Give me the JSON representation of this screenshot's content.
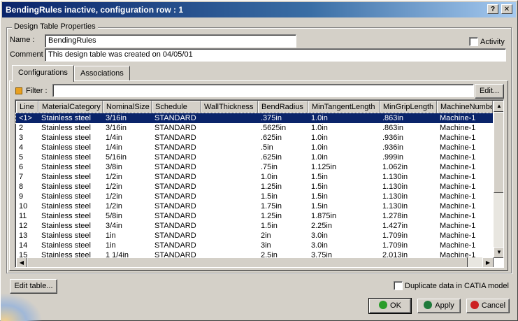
{
  "window": {
    "title": "BendingRules inactive, configuration row : 1",
    "help_glyph": "?",
    "close_glyph": "✕"
  },
  "group": {
    "label": "Design Table Properties",
    "name_label": "Name :",
    "name_value": "BendingRules",
    "comment_label": "Comment :",
    "comment_value": "This design table was created on 04/05/01",
    "activity_label": "Activity"
  },
  "tabs": [
    {
      "label": "Configurations"
    },
    {
      "label": "Associations"
    }
  ],
  "filter": {
    "label": "Filter :",
    "value": "",
    "edit_button": "Edit..."
  },
  "table": {
    "columns": [
      "Line",
      "MaterialCategory",
      "NominalSize",
      "Schedule",
      "WallThickness",
      "BendRadius",
      "MinTangentLength",
      "MinGripLength",
      "MachineNumbe"
    ],
    "rows": [
      [
        "<1>",
        "Stainless steel",
        "3/16in",
        "STANDARD",
        "",
        ".375in",
        "1.0in",
        ".863in",
        "Machine-1"
      ],
      [
        "2",
        "Stainless steel",
        "3/16in",
        "STANDARD",
        "",
        ".5625in",
        "1.0in",
        ".863in",
        "Machine-1"
      ],
      [
        "3",
        "Stainless steel",
        "1/4in",
        "STANDARD",
        "",
        ".625in",
        "1.0in",
        ".936in",
        "Machine-1"
      ],
      [
        "4",
        "Stainless steel",
        "1/4in",
        "STANDARD",
        "",
        ".5in",
        "1.0in",
        ".936in",
        "Machine-1"
      ],
      [
        "5",
        "Stainless steel",
        "5/16in",
        "STANDARD",
        "",
        ".625in",
        "1.0in",
        ".999in",
        "Machine-1"
      ],
      [
        "6",
        "Stainless steel",
        "3/8in",
        "STANDARD",
        "",
        ".75in",
        "1.125in",
        "1.062in",
        "Machine-1"
      ],
      [
        "7",
        "Stainless steel",
        "1/2in",
        "STANDARD",
        "",
        "1.0in",
        "1.5in",
        "1.130in",
        "Machine-1"
      ],
      [
        "8",
        "Stainless steel",
        "1/2in",
        "STANDARD",
        "",
        "1.25in",
        "1.5in",
        "1.130in",
        "Machine-1"
      ],
      [
        "9",
        "Stainless steel",
        "1/2in",
        "STANDARD",
        "",
        "1.5in",
        "1.5in",
        "1.130in",
        "Machine-1"
      ],
      [
        "10",
        "Stainless steel",
        "1/2in",
        "STANDARD",
        "",
        "1.75in",
        "1.5in",
        "1.130in",
        "Machine-1"
      ],
      [
        "11",
        "Stainless steel",
        "5/8in",
        "STANDARD",
        "",
        "1.25in",
        "1.875in",
        "1.278in",
        "Machine-1"
      ],
      [
        "12",
        "Stainless steel",
        "3/4in",
        "STANDARD",
        "",
        "1.5in",
        "2.25in",
        "1.427in",
        "Machine-1"
      ],
      [
        "13",
        "Stainless steel",
        "1in",
        "STANDARD",
        "",
        "2in",
        "3.0in",
        "1.709in",
        "Machine-1"
      ],
      [
        "14",
        "Stainless steel",
        "1in",
        "STANDARD",
        "",
        "3in",
        "3.0in",
        "1.709in",
        "Machine-1"
      ],
      [
        "15",
        "Stainless steel",
        "1 1/4in",
        "STANDARD",
        "",
        "2.5in",
        "3.75in",
        "2.013in",
        "Machine-1"
      ]
    ],
    "selected_row": 0
  },
  "footer": {
    "edit_table_button": "Edit table...",
    "duplicate_label": "Duplicate data in CATIA model",
    "ok_button": "OK",
    "apply_button": "Apply",
    "cancel_button": "Cancel"
  },
  "colors": {
    "ok": "#2a9d2a",
    "apply": "#1f7a3a",
    "cancel": "#cc2222",
    "selection": "#0a246a"
  },
  "icons": {
    "help": "help-icon",
    "close": "close-icon",
    "filter": "filter-icon"
  }
}
